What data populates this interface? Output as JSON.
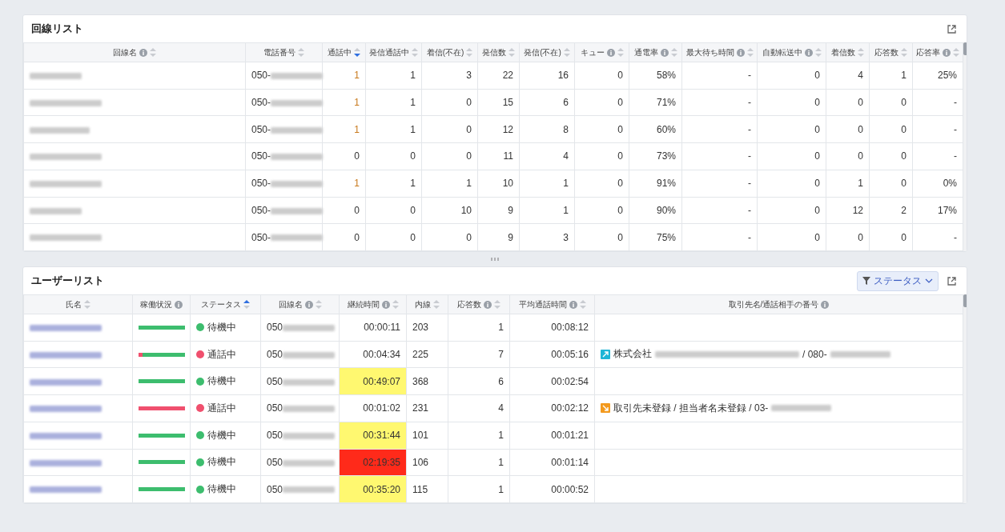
{
  "line_list": {
    "title": "回線リスト",
    "columns": [
      {
        "label": "回線名",
        "info": true,
        "sortable": true,
        "sort_asc": false,
        "sort_desc": false
      },
      {
        "label": "電話番号",
        "info": false,
        "sortable": true,
        "sort_asc": false,
        "sort_desc": false
      },
      {
        "label": "通話中",
        "info": false,
        "sortable": true,
        "sort_asc": false,
        "sort_desc": true
      },
      {
        "label": "発信通話中",
        "info": false,
        "sortable": true,
        "sort_asc": false,
        "sort_desc": false
      },
      {
        "label": "着信(不在)",
        "info": false,
        "sortable": true,
        "sort_asc": false,
        "sort_desc": false
      },
      {
        "label": "発信数",
        "info": false,
        "sortable": true,
        "sort_asc": false,
        "sort_desc": false
      },
      {
        "label": "発信(不在)",
        "info": false,
        "sortable": true,
        "sort_asc": false,
        "sort_desc": false
      },
      {
        "label": "キュー",
        "info": true,
        "sortable": true,
        "sort_asc": false,
        "sort_desc": false
      },
      {
        "label": "通電率",
        "info": true,
        "sortable": true,
        "sort_asc": false,
        "sort_desc": false
      },
      {
        "label": "最大待ち時間",
        "info": true,
        "sortable": true,
        "sort_asc": false,
        "sort_desc": false
      },
      {
        "label": "自動転送中",
        "info": true,
        "sortable": true,
        "sort_asc": false,
        "sort_desc": false
      },
      {
        "label": "着信数",
        "info": false,
        "sortable": true,
        "sort_asc": false,
        "sort_desc": false
      },
      {
        "label": "応答数",
        "info": false,
        "sortable": true,
        "sort_asc": false,
        "sort_desc": false
      },
      {
        "label": "応答率",
        "info": true,
        "sortable": true,
        "sort_asc": false,
        "sort_desc": false
      }
    ],
    "rows": [
      {
        "phone_prefix": "050-",
        "active": true,
        "values": [
          "1",
          "1",
          "3",
          "22",
          "16",
          "0",
          "58%",
          "-",
          "0",
          "4",
          "1",
          "25%"
        ]
      },
      {
        "phone_prefix": "050-",
        "active": true,
        "values": [
          "1",
          "1",
          "0",
          "15",
          "6",
          "0",
          "71%",
          "-",
          "0",
          "0",
          "0",
          "-"
        ]
      },
      {
        "phone_prefix": "050-",
        "active": true,
        "values": [
          "1",
          "1",
          "0",
          "12",
          "8",
          "0",
          "60%",
          "-",
          "0",
          "0",
          "0",
          "-"
        ]
      },
      {
        "phone_prefix": "050-",
        "active": false,
        "values": [
          "0",
          "0",
          "0",
          "11",
          "4",
          "0",
          "73%",
          "-",
          "0",
          "0",
          "0",
          "-"
        ]
      },
      {
        "phone_prefix": "050-",
        "active": true,
        "values": [
          "1",
          "1",
          "1",
          "10",
          "1",
          "0",
          "91%",
          "-",
          "0",
          "1",
          "0",
          "0%"
        ]
      },
      {
        "phone_prefix": "050-",
        "active": false,
        "values": [
          "0",
          "0",
          "10",
          "9",
          "1",
          "0",
          "90%",
          "-",
          "0",
          "12",
          "2",
          "17%"
        ]
      },
      {
        "phone_prefix": "050-",
        "active": false,
        "values": [
          "0",
          "0",
          "0",
          "9",
          "3",
          "0",
          "75%",
          "-",
          "0",
          "0",
          "0",
          "-"
        ]
      }
    ]
  },
  "user_list": {
    "title": "ユーザーリスト",
    "filter_button": "ステータス",
    "columns": [
      {
        "label": "氏名",
        "info": false,
        "sortable": true,
        "sort_asc": false,
        "sort_desc": false
      },
      {
        "label": "稼働状況",
        "info": true,
        "sortable": false
      },
      {
        "label": "ステータス",
        "info": false,
        "sortable": true,
        "sort_asc": true,
        "sort_desc": false
      },
      {
        "label": "回線名",
        "info": true,
        "sortable": true,
        "sort_asc": false,
        "sort_desc": false
      },
      {
        "label": "継続時間",
        "info": true,
        "sortable": true,
        "sort_asc": false,
        "sort_desc": false
      },
      {
        "label": "内線",
        "info": false,
        "sortable": true,
        "sort_asc": false,
        "sort_desc": false
      },
      {
        "label": "応答数",
        "info": true,
        "sortable": true,
        "sort_asc": false,
        "sort_desc": false
      },
      {
        "label": "平均通話時間",
        "info": true,
        "sortable": true,
        "sort_asc": false,
        "sort_desc": false
      },
      {
        "label": "取引先名/通話相手の番号",
        "info": true,
        "sortable": false
      }
    ],
    "rows": [
      {
        "level": 0,
        "status": "待機中",
        "color": "#3dbd6e",
        "line_prefix": "050",
        "duration": "00:00:11",
        "warning": false,
        "critical": false,
        "extension": "203",
        "answers": "1",
        "avg": "00:08:12"
      },
      {
        "level": 0.08,
        "status": "通話中",
        "color": "#f0506e",
        "line_prefix": "050",
        "duration": "00:04:34",
        "warning": false,
        "critical": false,
        "extension": "225",
        "answers": "7",
        "avg": "00:05:16",
        "partner": {
          "kind": "outgoing",
          "segments": [
            {
              "kind": "text",
              "text": "株式会社"
            },
            {
              "kind": "redacted"
            },
            {
              "kind": "text",
              "text": "/ 080-"
            },
            {
              "kind": "redacted"
            }
          ]
        }
      },
      {
        "level": 0,
        "status": "待機中",
        "color": "#3dbd6e",
        "line_prefix": "050",
        "duration": "00:49:07",
        "warning": true,
        "critical": false,
        "extension": "368",
        "answers": "6",
        "avg": "00:02:54"
      },
      {
        "level": 1,
        "status": "通話中",
        "color": "#f0506e",
        "line_prefix": "050",
        "duration": "00:01:02",
        "warning": false,
        "critical": false,
        "extension": "231",
        "answers": "4",
        "avg": "00:02:12",
        "partner": {
          "kind": "incoming",
          "segments": [
            {
              "kind": "text",
              "text": "取引先未登録 / 担当者名未登録 / 03-"
            },
            {
              "kind": "redacted"
            }
          ]
        }
      },
      {
        "level": 0,
        "status": "待機中",
        "color": "#3dbd6e",
        "line_prefix": "050",
        "duration": "00:31:44",
        "warning": true,
        "critical": false,
        "extension": "101",
        "answers": "1",
        "avg": "00:01:21"
      },
      {
        "level": 0,
        "status": "待機中",
        "color": "#3dbd6e",
        "line_prefix": "050",
        "duration": "02:19:35",
        "critical": true,
        "extension": "106",
        "answers": "1",
        "avg": "00:01:14"
      },
      {
        "level": 0,
        "status": "待機中",
        "color": "#3dbd6e",
        "line_prefix": "050",
        "duration": "00:35:20",
        "warning": true,
        "critical": false,
        "extension": "115",
        "answers": "1",
        "avg": "00:00:52"
      }
    ]
  }
}
